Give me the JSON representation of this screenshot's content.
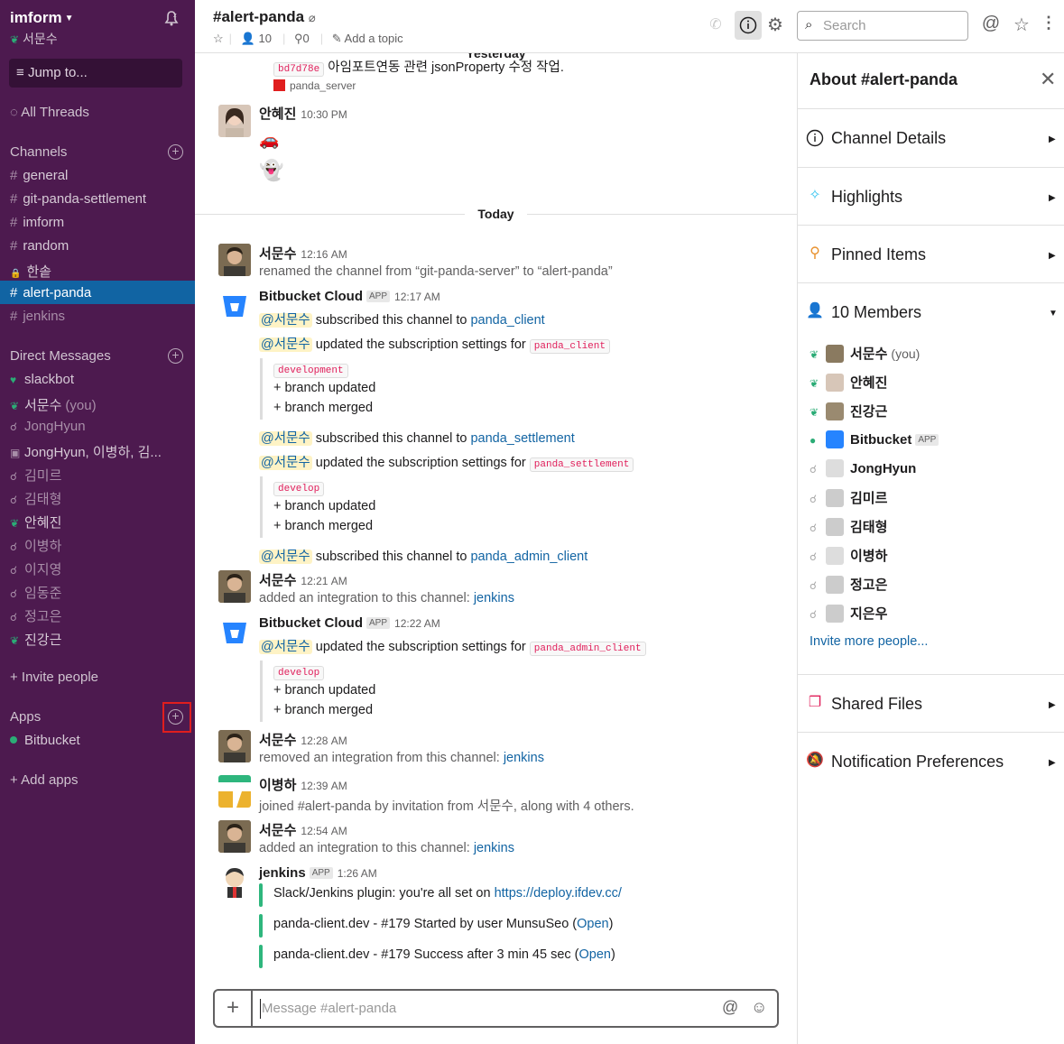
{
  "workspace": {
    "name": "imform",
    "user": "서문수"
  },
  "sidebar": {
    "jump_label": "Jump to...",
    "threads_label": "All Threads",
    "channels_header": "Channels",
    "channels": [
      {
        "name": "general",
        "state": "normal"
      },
      {
        "name": "git-panda-settlement",
        "state": "normal"
      },
      {
        "name": "imform",
        "state": "normal"
      },
      {
        "name": "random",
        "state": "normal"
      },
      {
        "name": "한솥",
        "state": "private"
      },
      {
        "name": "alert-panda",
        "state": "active"
      },
      {
        "name": "jenkins",
        "state": "dim"
      }
    ],
    "dm_header": "Direct Messages",
    "dms": [
      {
        "name": "slackbot",
        "suffix": "",
        "status": "heart"
      },
      {
        "name": "서문수",
        "suffix": "(you)",
        "status": "online"
      },
      {
        "name": "JongHyun",
        "suffix": "",
        "status": "away"
      },
      {
        "name": "JongHyun, 이병하, 김...",
        "suffix": "",
        "status": "group"
      },
      {
        "name": "김미르",
        "suffix": "",
        "status": "away"
      },
      {
        "name": "김태형",
        "suffix": "",
        "status": "away"
      },
      {
        "name": "안혜진",
        "suffix": "",
        "status": "online"
      },
      {
        "name": "이병하",
        "suffix": "",
        "status": "away"
      },
      {
        "name": "이지영",
        "suffix": "",
        "status": "away"
      },
      {
        "name": "임동준",
        "suffix": "",
        "status": "away"
      },
      {
        "name": "정고은",
        "suffix": "",
        "status": "away"
      },
      {
        "name": "진강근",
        "suffix": "",
        "status": "online"
      }
    ],
    "invite_label": "+ Invite people",
    "apps_header": "Apps",
    "apps": [
      {
        "name": "Bitbucket"
      }
    ],
    "add_apps_label": "+ Add apps"
  },
  "header": {
    "channel": "#alert-panda",
    "members": "10",
    "pins": "0",
    "topic_placeholder": "Add a topic",
    "search_placeholder": "Search"
  },
  "messages": {
    "yesterday_label": "Yesterday",
    "today_label": "Today",
    "top_commit": "bd7d78e",
    "top_commit_text": "아임포트연동 관련 jsonProperty 수정 작업.",
    "top_repo": "panda_server",
    "hye_name": "안혜진",
    "hye_time": "10:30 PM",
    "m1_name": "서문수",
    "m1_time": "12:16 AM",
    "m1_text": "renamed the channel from “git-panda-server” to “alert-panda”",
    "bb1_name": "Bitbucket Cloud",
    "bb1_time": "12:17 AM",
    "app_tag": "APP",
    "mention_user": "@서문수",
    "subscribed_text": "subscribed this channel to",
    "updated_text": "updated the subscription settings for",
    "repo_client": "panda_client",
    "repo_settlement": "panda_settlement",
    "repo_admin_client": "panda_admin_client",
    "branch_development": "development",
    "branch_develop": "develop",
    "branch_updated": "+ branch updated",
    "branch_merged": "+ branch merged",
    "m2_name": "서문수",
    "m2_time": "12:21 AM",
    "added_integration": "added an integration to this channel:",
    "removed_integration": "removed an integration from this channel:",
    "jenkins_link": "jenkins",
    "bb2_name": "Bitbucket Cloud",
    "bb2_time": "12:22 AM",
    "m3_name": "서문수",
    "m3_time": "12:28 AM",
    "m4_name": "이병하",
    "m4_time": "12:39 AM",
    "m4_text": "joined #alert-panda by invitation from 서문수, along with 4 others.",
    "m5_name": "서문수",
    "m5_time": "12:54 AM",
    "jk_name": "jenkins",
    "jk_time": "1:26 AM",
    "jk_line1": "Slack/Jenkins plugin: you're all set on",
    "jk_line1_link": "https://deploy.ifdev.cc/",
    "jk_line2": "panda-client.dev - #179 Started by user MunsuSeo",
    "jk_line3": "panda-client.dev - #179 Success after 3 min 45 sec",
    "open_label": "Open"
  },
  "composer": {
    "placeholder": "Message #alert-panda"
  },
  "panel": {
    "title": "About #alert-panda",
    "channel_details": "Channel Details",
    "highlights": "Highlights",
    "pinned": "Pinned Items",
    "members_label": "10 Members",
    "members": [
      {
        "name": "서문수",
        "suffix": "(you)",
        "online": true,
        "bold": true
      },
      {
        "name": "안혜진",
        "suffix": "",
        "online": true,
        "bold": true
      },
      {
        "name": "진강근",
        "suffix": "",
        "online": true,
        "bold": true
      },
      {
        "name": "Bitbucket",
        "suffix": "APP",
        "online": true,
        "bold": true
      },
      {
        "name": "JongHyun",
        "suffix": "",
        "online": false,
        "bold": true
      },
      {
        "name": "김미르",
        "suffix": "",
        "online": false,
        "bold": true
      },
      {
        "name": "김태형",
        "suffix": "",
        "online": false,
        "bold": true
      },
      {
        "name": "이병하",
        "suffix": "",
        "online": false,
        "bold": true
      },
      {
        "name": "정고은",
        "suffix": "",
        "online": false,
        "bold": true
      },
      {
        "name": "지은우",
        "suffix": "",
        "online": false,
        "bold": true
      }
    ],
    "invite_more": "Invite more people...",
    "shared_files": "Shared Files",
    "notif_prefs": "Notification Preferences"
  },
  "colors": {
    "sidebar_bg": "#4d1a4f",
    "active": "#1164a3",
    "online": "#2bac76",
    "link": "#1264a3"
  }
}
